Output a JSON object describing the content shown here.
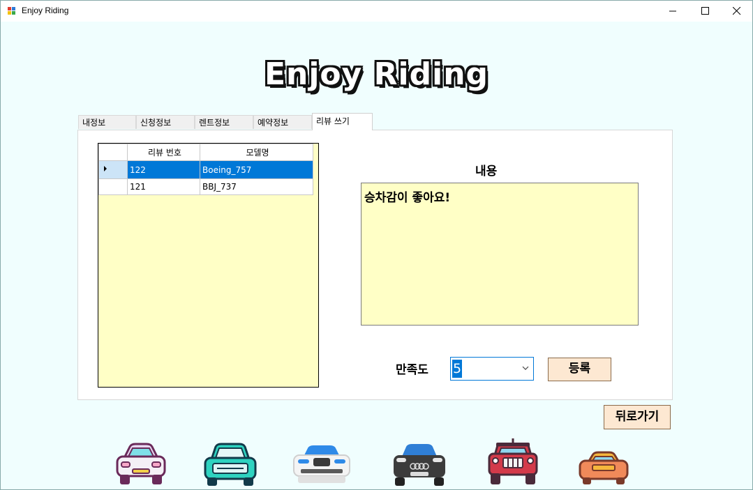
{
  "window": {
    "title": "Enjoy Riding"
  },
  "logo": {
    "text": "Enjoy Riding"
  },
  "tabs": [
    {
      "label": "내정보"
    },
    {
      "label": "신청정보"
    },
    {
      "label": "렌트정보"
    },
    {
      "label": "예약정보"
    },
    {
      "label": "리뷰 쓰기",
      "active": true
    }
  ],
  "review_grid": {
    "columns": [
      "리뷰 번호",
      "모델명"
    ],
    "rows": [
      {
        "id": "122",
        "model": "Boeing_757",
        "selected": true
      },
      {
        "id": "121",
        "model": "BBJ_737",
        "selected": false
      }
    ]
  },
  "content": {
    "label": "내용",
    "text": "승차감이 좋아요!"
  },
  "satisfaction": {
    "label": "만족도",
    "value": "5"
  },
  "buttons": {
    "register": "등록",
    "back": "뒤로가기"
  },
  "cars": [
    "car-pink-icon",
    "car-teal-icon",
    "car-white-icon",
    "car-dark-icon",
    "car-red-icon",
    "car-orange-icon"
  ],
  "colors": {
    "window_bg": "#f0fefe",
    "grid_bg": "#ffffc6",
    "selection": "#0078d7",
    "button_bg": "#fde8d2"
  }
}
